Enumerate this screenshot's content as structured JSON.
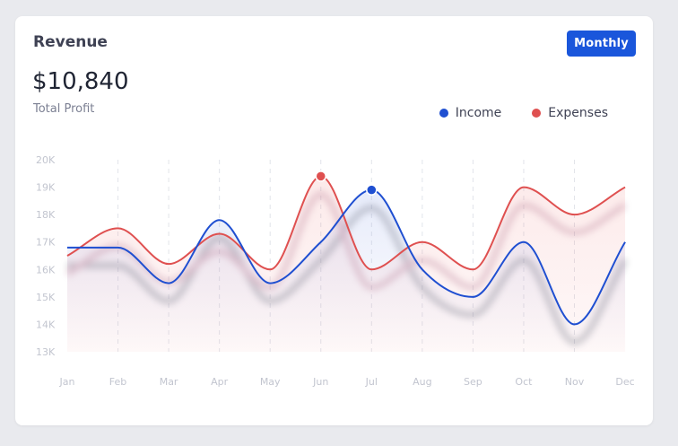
{
  "card": {
    "title": "Revenue",
    "period_button": "Monthly",
    "total_value": "$10,840",
    "total_label": "Total Profit"
  },
  "colors": {
    "income": "#1f4fd1",
    "expenses": "#df5050",
    "button": "#1a56db"
  },
  "chart_data": {
    "type": "line",
    "categories": [
      "Jan",
      "Feb",
      "Mar",
      "Apr",
      "May",
      "Jun",
      "Jul",
      "Aug",
      "Sep",
      "Oct",
      "Nov",
      "Dec"
    ],
    "series": [
      {
        "name": "Income",
        "color": "#1f4fd1",
        "values": [
          16800,
          16800,
          15500,
          17800,
          15500,
          17000,
          18900,
          16000,
          15000,
          17000,
          14000,
          17000
        ],
        "highlight_index": 6
      },
      {
        "name": "Expenses",
        "color": "#df5050",
        "values": [
          16500,
          17500,
          16200,
          17300,
          16000,
          19400,
          16000,
          17000,
          16000,
          19000,
          18000,
          19000
        ],
        "highlight_index": 5
      }
    ],
    "ylim": [
      13000,
      20000
    ],
    "y_ticks": [
      "13K",
      "14K",
      "15K",
      "16K",
      "17K",
      "18K",
      "19K",
      "20K"
    ],
    "grid": "vertical-dashed",
    "legend": "top-right"
  }
}
